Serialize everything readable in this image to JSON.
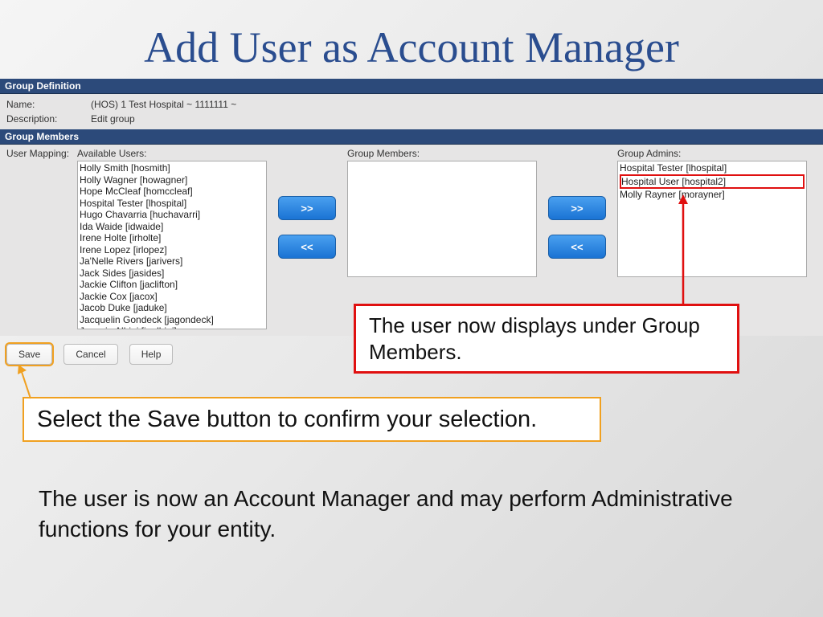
{
  "title": "Add User as Account Manager",
  "groupDef": {
    "header": "Group Definition",
    "nameLabel": "Name:",
    "nameValue": "(HOS) 1 Test Hospital ~ 1111111 ~",
    "descLabel": "Description:",
    "descValue": "Edit group"
  },
  "groupMembers": {
    "header": "Group Members",
    "mappingLabel": "User Mapping:",
    "availableLabel": "Available Users:",
    "available": [
      "Holly Smith [hosmith]",
      "Holly Wagner [howagner]",
      "Hope McCleaf [homccleaf]",
      "Hospital Tester [lhospital]",
      "Hugo Chavarria [huchavarri]",
      "Ida Waide [idwaide]",
      "Irene Holte [irholte]",
      "Irene Lopez [irlopez]",
      "Ja'Nelle Rivers [jarivers]",
      "Jack Sides [jasides]",
      "Jackie Clifton [jaclifton]",
      "Jackie Cox [jacox]",
      "Jacob Duke [jaduke]",
      "Jacquelin Gondeck [jagondeck]",
      "Jacquie Albini [jaalbini]"
    ],
    "membersLabel": "Group Members:",
    "adminsLabel": "Group Admins:",
    "admins": [
      "Hospital Tester [lhospital]",
      "Hospital User [hospital2]",
      "Molly Rayner [morayner]"
    ],
    "addBtn": ">>",
    "removeBtn": "<<"
  },
  "footer": {
    "save": "Save",
    "cancel": "Cancel",
    "help": "Help"
  },
  "callouts": {
    "red": "The user now displays under Group Members.",
    "orange": "Select the Save button to confirm your selection.",
    "body": "The user is now an Account Manager and may perform Administrative functions for your entity."
  }
}
